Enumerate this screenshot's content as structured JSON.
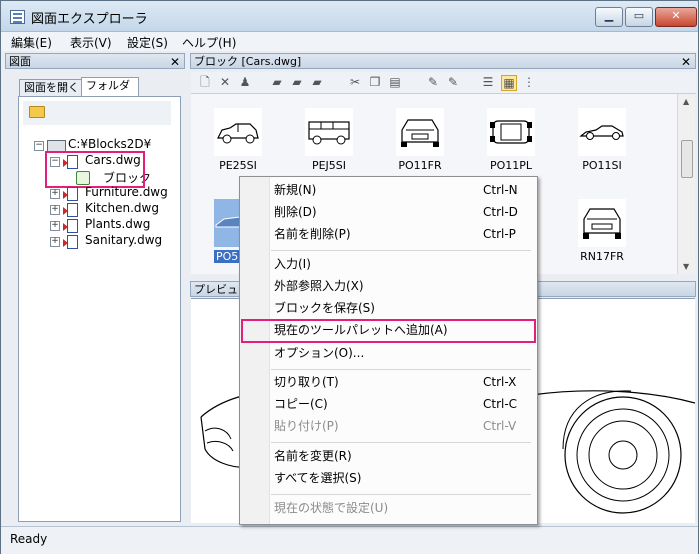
{
  "window": {
    "title": "図面エクスプローラ",
    "controls": {
      "minimize": "▁",
      "maximize": "▭",
      "close": "✕"
    }
  },
  "menubar": [
    "編集(E)",
    "表示(V)",
    "設定(S)",
    "ヘルプ(H)"
  ],
  "left_pane": {
    "title": "図面",
    "close": "✕",
    "tabs": [
      "図面を開く",
      "フォルダ"
    ],
    "tree": {
      "root": "C:¥Blocks2D¥",
      "files": [
        {
          "name": "Cars.dwg",
          "expander": "−",
          "child": "ブロック"
        },
        {
          "name": "Furniture.dwg",
          "expander": "+"
        },
        {
          "name": "Kitchen.dwg",
          "expander": "+"
        },
        {
          "name": "Plants.dwg",
          "expander": "+"
        },
        {
          "name": "Sanitary.dwg",
          "expander": "+"
        }
      ]
    }
  },
  "blocks_pane": {
    "title": "ブロック [Cars.dwg]",
    "close": "✕",
    "items": [
      "PE25SI",
      "PEJ5SI",
      "PO11FR",
      "PO11PL",
      "PO11SI",
      "PO5",
      "RN17FR"
    ]
  },
  "preview_pane": {
    "title": "プレビュー"
  },
  "context_menu": {
    "groups": [
      [
        {
          "label": "新規(N)",
          "shortcut": "Ctrl-N"
        },
        {
          "label": "削除(D)",
          "shortcut": "Ctrl-D"
        },
        {
          "label": "名前を削除(P)",
          "shortcut": "Ctrl-P"
        }
      ],
      [
        {
          "label": "入力(I)"
        },
        {
          "label": "外部参照入力(X)"
        },
        {
          "label": "ブロックを保存(S)"
        },
        {
          "label": "現在のツールパレットへ追加(A)",
          "highlighted": true
        },
        {
          "label": "オプション(O)..."
        }
      ],
      [
        {
          "label": "切り取り(T)",
          "shortcut": "Ctrl-X"
        },
        {
          "label": "コピー(C)",
          "shortcut": "Ctrl-C"
        },
        {
          "label": "貼り付け(P)",
          "shortcut": "Ctrl-V",
          "disabled": true
        }
      ],
      [
        {
          "label": "名前を変更(R)"
        },
        {
          "label": "すべてを選択(S)"
        }
      ],
      [
        {
          "label": "現在の状態で設定(U)",
          "disabled": true
        }
      ]
    ]
  },
  "status": {
    "text": "Ready"
  },
  "colors": {
    "highlight": "#e0207a",
    "selection": "#8fb6e4"
  }
}
